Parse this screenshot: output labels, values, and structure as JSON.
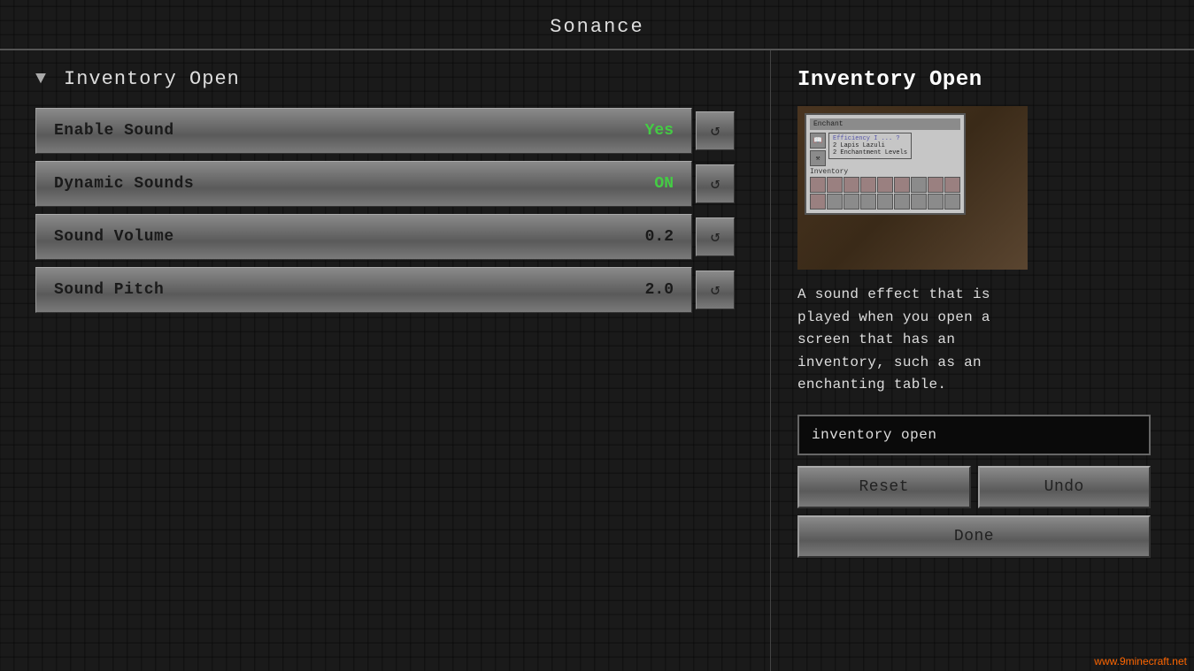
{
  "title": "Sonance",
  "left_panel": {
    "header": {
      "filter_icon": "▼",
      "title": "Inventory Open"
    },
    "settings": [
      {
        "label": "Enable Sound",
        "value": "Yes",
        "value_type": "yes",
        "reset_icon": "↺"
      },
      {
        "label": "Dynamic Sounds",
        "value": "ON",
        "value_type": "on",
        "reset_icon": "↺"
      },
      {
        "label": "Sound Volume",
        "value": "0.2",
        "value_type": "number",
        "reset_icon": "↺"
      },
      {
        "label": "Sound Pitch",
        "value": "2.0",
        "value_type": "number",
        "reset_icon": "↺"
      }
    ]
  },
  "right_panel": {
    "title": "Inventory Open",
    "description": "A sound effect that is\nplayed when you open a\nscreen that has an\ninventory, such as an\nenchanting table.",
    "sound_name": "inventory open",
    "buttons": {
      "reset": "Reset",
      "undo": "Undo",
      "done": "Done"
    }
  },
  "watermark": "www.9minecraft.net"
}
